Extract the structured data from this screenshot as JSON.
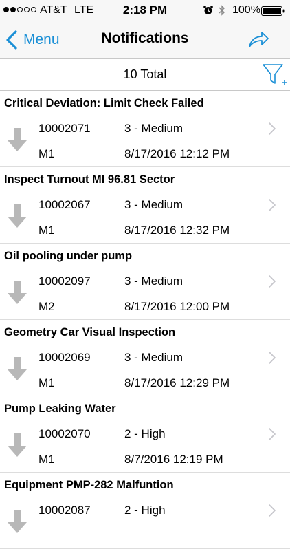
{
  "status_bar": {
    "carrier": "AT&T",
    "network": "LTE",
    "time": "2:18 PM",
    "battery": "100%",
    "signal_bars_filled": 2,
    "signal_bars_total": 5
  },
  "nav": {
    "back_label": "Menu",
    "title": "Notifications",
    "share_icon": "share-icon"
  },
  "summary": {
    "total": "10 Total",
    "filter_icon": "filter-add-icon"
  },
  "colors": {
    "accent": "#1a8fd6",
    "arrow": "#b8b8b8",
    "chevron": "#c7c7cc"
  },
  "notifications": [
    {
      "title": "Critical Deviation: Limit Check Failed",
      "id": "10002071",
      "priority": "3 - Medium",
      "code": "M1",
      "date": "8/17/2016 12:12 PM"
    },
    {
      "title": "Inspect Turnout MI 96.81 Sector",
      "id": "10002067",
      "priority": "3 - Medium",
      "code": "M1",
      "date": "8/17/2016 12:32 PM"
    },
    {
      "title": "Oil pooling under pump",
      "id": "10002097",
      "priority": "3 - Medium",
      "code": "M2",
      "date": "8/17/2016 12:00 PM"
    },
    {
      "title": "Geometry Car Visual Inspection",
      "id": "10002069",
      "priority": "3 - Medium",
      "code": "M1",
      "date": "8/17/2016 12:29 PM"
    },
    {
      "title": "Pump Leaking Water",
      "id": "10002070",
      "priority": "2 - High",
      "code": "M1",
      "date": "8/7/2016 12:19 PM"
    },
    {
      "title": "Equipment PMP-282 Malfuntion",
      "id": "10002087",
      "priority": "2 - High",
      "code": "",
      "date": ""
    }
  ]
}
